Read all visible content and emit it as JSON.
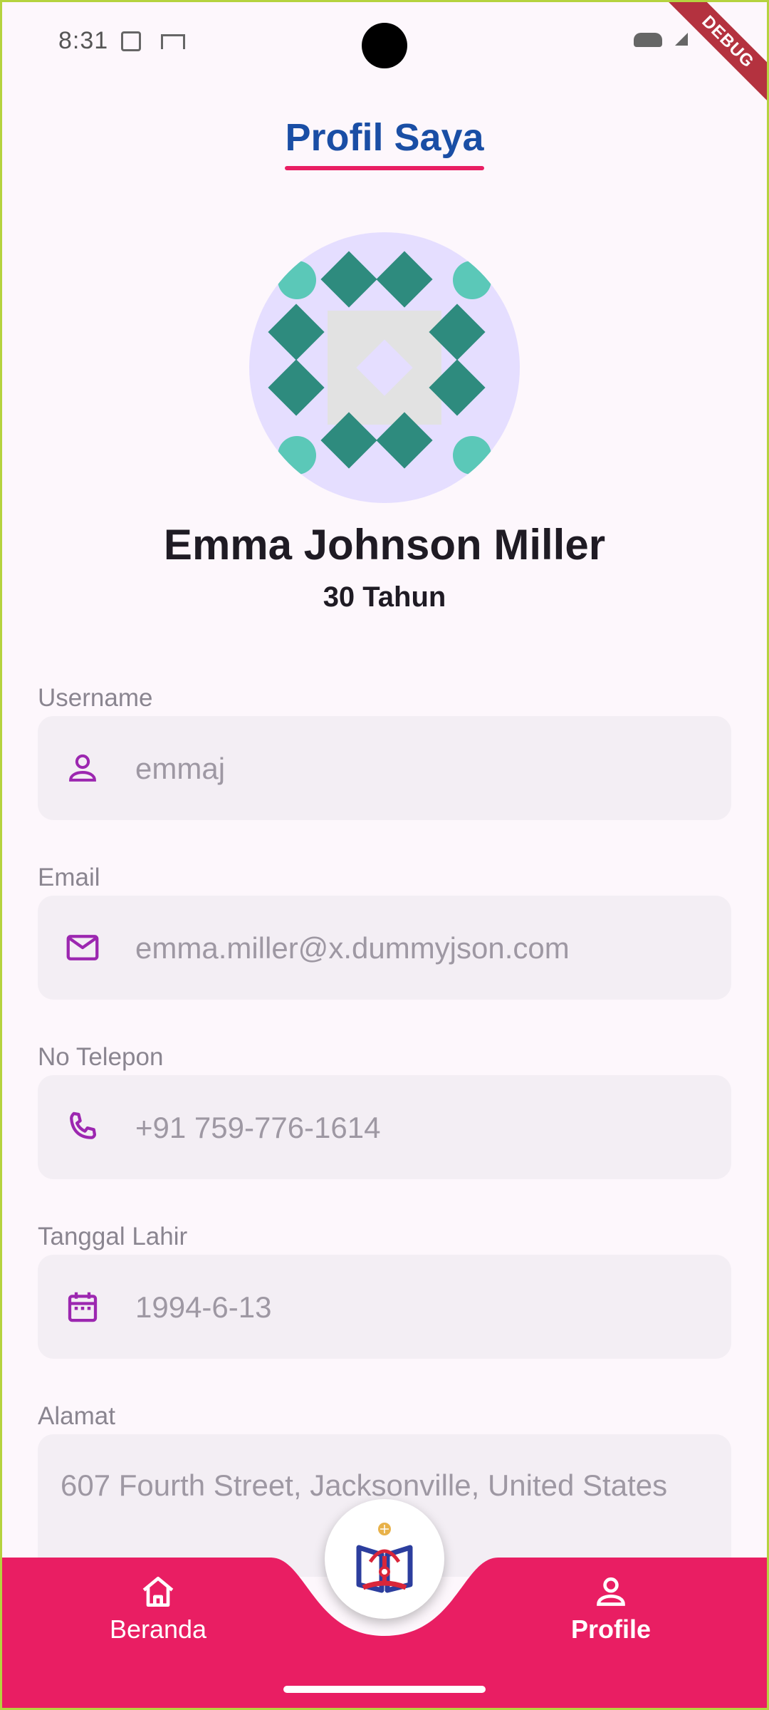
{
  "status": {
    "time": "8:31"
  },
  "debug_banner": "DEBUG",
  "header": {
    "title": "Profil Saya"
  },
  "profile": {
    "name": "Emma Johnson Miller",
    "age": "30 Tahun"
  },
  "fields": [
    {
      "label": "Username",
      "value": "emmaj",
      "icon": "person-icon"
    },
    {
      "label": "Email",
      "value": "emma.miller@x.dummyjson.com",
      "icon": "mail-icon"
    },
    {
      "label": "No Telepon",
      "value": "+91 759-776-1614",
      "icon": "phone-icon"
    },
    {
      "label": "Tanggal Lahir",
      "value": "1994-6-13",
      "icon": "calendar-icon"
    },
    {
      "label": "Alamat",
      "value": "607 Fourth Street, Jacksonville, United States",
      "icon": ""
    }
  ],
  "nav": {
    "items": [
      {
        "label": "Beranda",
        "icon": "home-icon",
        "active": false
      },
      {
        "label": "Profile",
        "icon": "person-icon",
        "active": true
      }
    ],
    "fab_icon": "app-logo"
  },
  "colors": {
    "accent": "#E91E63",
    "title": "#1A4EA5",
    "icon": "#9C27B0",
    "background": "#FDF7FC",
    "field_bg": "#F3EEF4"
  }
}
